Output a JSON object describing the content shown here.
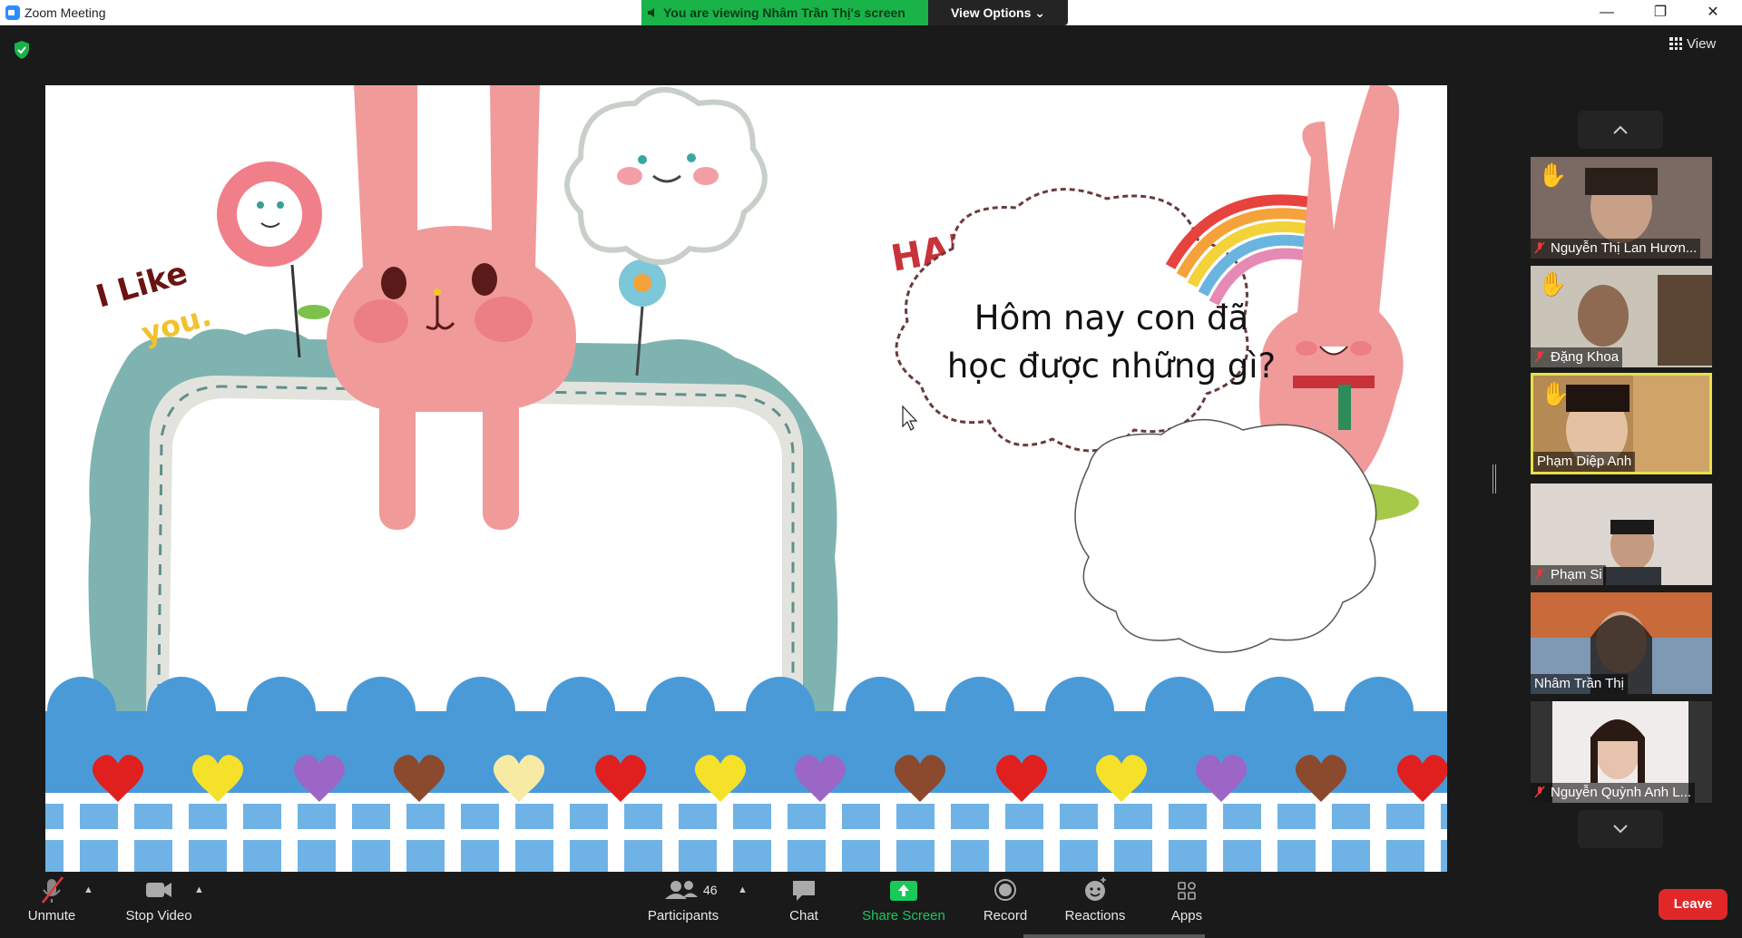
{
  "titlebar": {
    "app_title": "Zoom Meeting"
  },
  "banner": {
    "viewing_text": "You are viewing Nhâm Trần Thị's screen",
    "view_options": "View Options ⌄"
  },
  "view_button": {
    "label": "View"
  },
  "slide": {
    "question": "Hôm nay con đã học được những gì?"
  },
  "participants_panel": {
    "tiles": [
      {
        "name": "Nguyễn Thị Lan Hươn...",
        "muted": true,
        "hand_raised": true,
        "active": false
      },
      {
        "name": "Đặng Khoa",
        "muted": true,
        "hand_raised": true,
        "active": false
      },
      {
        "name": "Phạm Diệp Anh",
        "muted": false,
        "hand_raised": true,
        "active": true
      },
      {
        "name": "Phạm Si",
        "muted": true,
        "hand_raised": false,
        "active": false
      },
      {
        "name": "Nhâm Trần Thị",
        "muted": false,
        "hand_raised": false,
        "active": false
      },
      {
        "name": "Nguyễn Quỳnh Anh L...",
        "muted": true,
        "hand_raised": false,
        "active": false
      }
    ]
  },
  "toolbar": {
    "unmute": "Unmute",
    "stop_video": "Stop Video",
    "participants": "Participants",
    "participants_count": "46",
    "chat": "Chat",
    "share_screen": "Share Screen",
    "record": "Record",
    "reactions": "Reactions",
    "apps": "Apps",
    "leave": "Leave"
  },
  "colors": {
    "share_green": "#19c95a",
    "leave_red": "#e02828",
    "active_tile_border": "#e8e04a",
    "banner_green": "#19b34a"
  }
}
